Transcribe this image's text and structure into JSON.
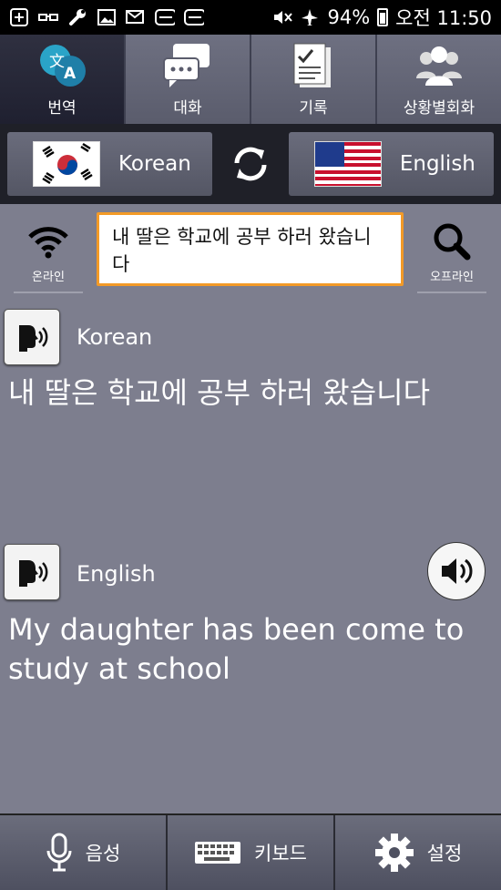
{
  "status": {
    "battery": "94%",
    "time": "오전 11:50",
    "icons": [
      "add-icon",
      "glasses-icon",
      "wrench-icon",
      "image-icon",
      "mail-icon",
      "band-icon",
      "band-icon",
      "mute-icon",
      "airplane-icon",
      "battery-icon"
    ]
  },
  "tabs": [
    {
      "label": "번역",
      "icon": "translate-icon"
    },
    {
      "label": "대화",
      "icon": "chat-icon"
    },
    {
      "label": "기록",
      "icon": "notes-icon"
    },
    {
      "label": "상황별회화",
      "icon": "people-icon"
    }
  ],
  "langbar": {
    "source_lang": "Korean",
    "target_lang": "English"
  },
  "input": {
    "online_label": "온라인",
    "offline_label": "오프라인",
    "source_text": "내 딸은 학교에 공부 하러 왔습니다"
  },
  "result": {
    "source_lang": "Korean",
    "source_text": "내 딸은 학교에 공부 하러 왔습니다",
    "target_lang": "English",
    "target_text": "My daughter has been come to study at school"
  },
  "bottom": {
    "voice": "음성",
    "keyboard": "키보드",
    "settings": "설정"
  },
  "colors": {
    "background": "#7d7e8e",
    "accent_border": "#f39a27",
    "active_tab": "#1f2030"
  }
}
